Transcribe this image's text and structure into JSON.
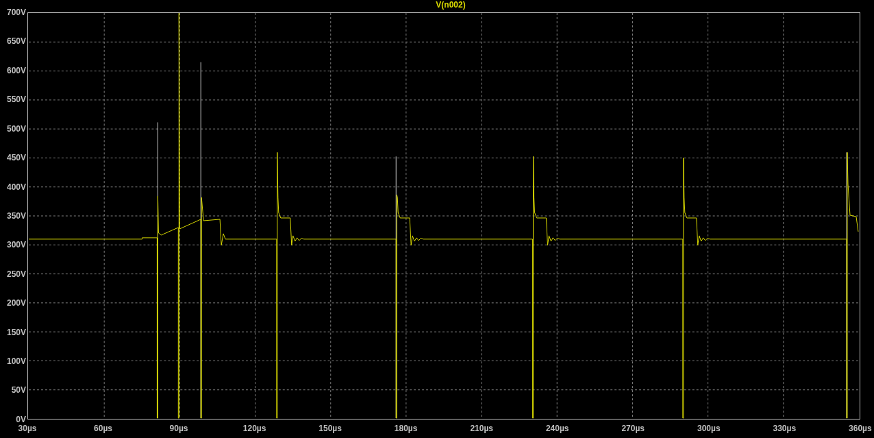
{
  "plot": {
    "title": "V(n002)",
    "y_axis": {
      "labels": [
        "700V",
        "650V",
        "600V",
        "550V",
        "500V",
        "450V",
        "400V",
        "350V",
        "300V",
        "250V",
        "200V",
        "150V",
        "100V",
        "50V",
        "0V"
      ]
    },
    "x_axis": {
      "labels": [
        "30µs",
        "60µs",
        "90µs",
        "120µs",
        "150µs",
        "180µs",
        "210µs",
        "240µs",
        "270µs",
        "300µs",
        "330µs",
        "360µs"
      ]
    }
  }
}
